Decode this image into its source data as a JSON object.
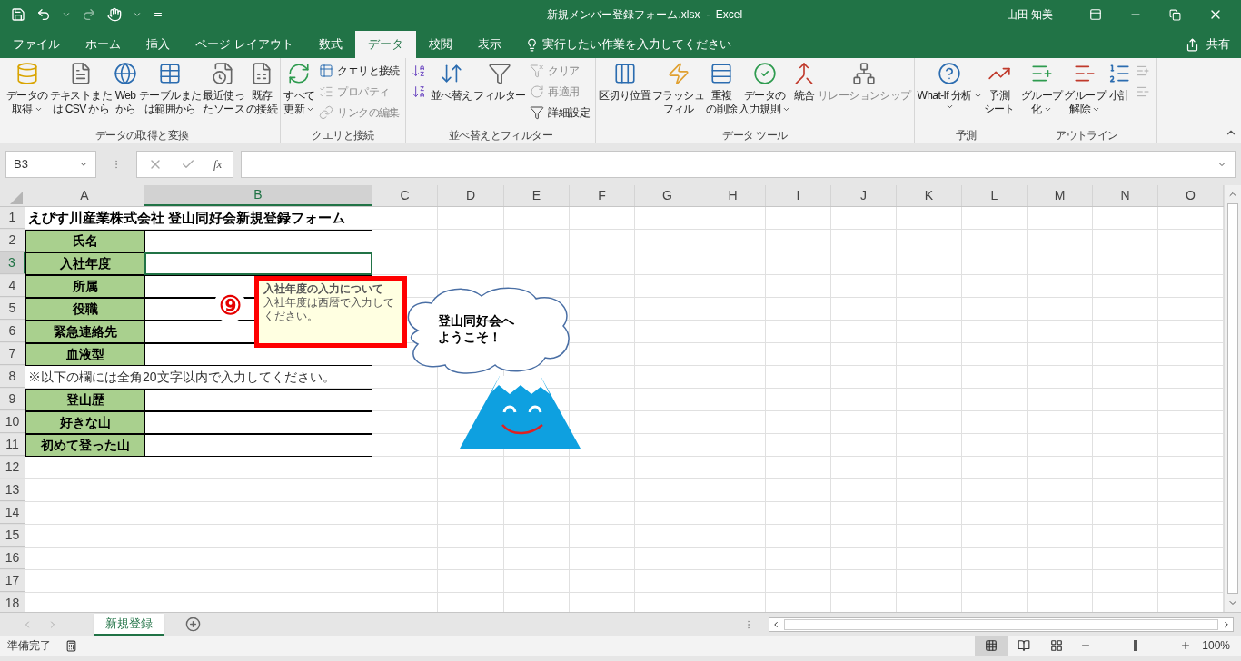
{
  "window": {
    "title": "新規メンバー登録フォーム.xlsx  -  Excel",
    "user": "山田 知美"
  },
  "tabs": [
    {
      "label": "ファイル",
      "selected": false
    },
    {
      "label": "ホーム",
      "selected": false
    },
    {
      "label": "挿入",
      "selected": false
    },
    {
      "label": "ページ レイアウト",
      "selected": false
    },
    {
      "label": "数式",
      "selected": false
    },
    {
      "label": "データ",
      "selected": true
    },
    {
      "label": "校閲",
      "selected": false
    },
    {
      "label": "表示",
      "selected": false
    }
  ],
  "tell_me": {
    "placeholder": "実行したい作業を入力してください"
  },
  "share": "共有",
  "ribbon": [
    {
      "label": "データの取得と変換",
      "items": [
        {
          "kind": "large",
          "lines": [
            "データの",
            "取得"
          ],
          "dropdown": true,
          "disabled": false
        },
        {
          "kind": "large",
          "lines": [
            "テキストまた",
            "は CSV から"
          ],
          "dropdown": false,
          "disabled": false
        },
        {
          "kind": "large",
          "lines": [
            "Web",
            "から"
          ],
          "dropdown": false,
          "disabled": false
        },
        {
          "kind": "large",
          "lines": [
            "テーブルまた",
            "は範囲から"
          ],
          "dropdown": false,
          "disabled": false
        },
        {
          "kind": "large",
          "lines": [
            "最近使っ",
            "たソース"
          ],
          "dropdown": false,
          "disabled": false
        },
        {
          "kind": "large",
          "lines": [
            "既存",
            "の接続"
          ],
          "dropdown": false,
          "disabled": false
        }
      ]
    },
    {
      "label": "クエリと接続",
      "items": [
        {
          "kind": "large",
          "lines": [
            "すべて",
            "更新"
          ],
          "dropdown": true,
          "disabled": false
        },
        {
          "kind": "stack",
          "items": [
            {
              "label": "クエリと接続",
              "disabled": false
            },
            {
              "label": "プロパティ",
              "disabled": true
            },
            {
              "label": "リンクの編集",
              "disabled": true
            }
          ]
        }
      ]
    },
    {
      "label": "並べ替えとフィルター",
      "items": [
        {
          "kind": "stack",
          "items": [
            {
              "disabled": false
            },
            {
              "disabled": false
            }
          ]
        },
        {
          "kind": "large",
          "lines": [
            "並べ替え"
          ],
          "dropdown": false,
          "disabled": false
        },
        {
          "kind": "large",
          "lines": [
            "フィルター"
          ],
          "dropdown": false,
          "disabled": false
        },
        {
          "kind": "stack",
          "items": [
            {
              "label": "クリア",
              "disabled": true
            },
            {
              "label": "再適用",
              "disabled": true
            },
            {
              "label": "詳細設定",
              "disabled": false
            }
          ]
        }
      ]
    },
    {
      "label": "データ ツール",
      "items": [
        {
          "kind": "large",
          "lines": [
            "区切り位置"
          ],
          "dropdown": false,
          "disabled": false
        },
        {
          "kind": "large",
          "lines": [
            "フラッシュ",
            "フィル"
          ],
          "dropdown": false,
          "disabled": false
        },
        {
          "kind": "large",
          "lines": [
            "重複",
            "の削除"
          ],
          "dropdown": false,
          "disabled": false
        },
        {
          "kind": "large",
          "lines": [
            "データの",
            "入力規則"
          ],
          "dropdown": true,
          "disabled": false
        },
        {
          "kind": "large",
          "lines": [
            "統合"
          ],
          "dropdown": false,
          "disabled": false
        },
        {
          "kind": "large",
          "lines": [
            "リレーションシップ"
          ],
          "dropdown": false,
          "disabled": true
        }
      ]
    },
    {
      "label": "予測",
      "items": [
        {
          "kind": "large",
          "lines": [
            "What-If 分析"
          ],
          "dropdown": true,
          "disabled": false
        },
        {
          "kind": "large",
          "lines": [
            "予測",
            "シート"
          ],
          "dropdown": false,
          "disabled": false
        }
      ]
    },
    {
      "label": "アウトライン",
      "items": [
        {
          "kind": "large",
          "lines": [
            "グループ",
            "化"
          ],
          "dropdown": true,
          "disabled": false
        },
        {
          "kind": "large",
          "lines": [
            "グループ",
            "解除"
          ],
          "dropdown": true,
          "disabled": false
        },
        {
          "kind": "large",
          "lines": [
            "小計"
          ],
          "dropdown": false,
          "disabled": false
        },
        {
          "kind": "stack",
          "items": [
            {
              "disabled": true
            },
            {
              "disabled": true
            }
          ]
        }
      ]
    }
  ],
  "name_box": "B3",
  "formula_bar": {
    "function_label": "fx"
  },
  "columns": [
    {
      "label": "A",
      "selected": false
    },
    {
      "label": "B",
      "selected": true
    },
    {
      "label": "C",
      "selected": false
    },
    {
      "label": "D",
      "selected": false
    },
    {
      "label": "E",
      "selected": false
    },
    {
      "label": "F",
      "selected": false
    },
    {
      "label": "G",
      "selected": false
    },
    {
      "label": "H",
      "selected": false
    },
    {
      "label": "I",
      "selected": false
    },
    {
      "label": "J",
      "selected": false
    },
    {
      "label": "K",
      "selected": false
    },
    {
      "label": "L",
      "selected": false
    },
    {
      "label": "M",
      "selected": false
    },
    {
      "label": "N",
      "selected": false
    },
    {
      "label": "O",
      "selected": false
    }
  ],
  "rows": [
    {
      "number": "1",
      "selected": false,
      "cells": [
        {
          "kind": "title",
          "text": "えびす川産業株式会社  登山同好会新規登録フォーム"
        }
      ]
    },
    {
      "number": "2",
      "selected": false,
      "cells": [
        {
          "kind": "label",
          "text": "氏名"
        },
        {
          "kind": "input",
          "selected": false
        }
      ]
    },
    {
      "number": "3",
      "selected": true,
      "cells": [
        {
          "kind": "label",
          "text": "入社年度"
        },
        {
          "kind": "input",
          "selected": true
        }
      ]
    },
    {
      "number": "4",
      "selected": false,
      "cells": [
        {
          "kind": "label",
          "text": "所属"
        },
        {
          "kind": "input",
          "selected": false
        }
      ]
    },
    {
      "number": "5",
      "selected": false,
      "cells": [
        {
          "kind": "label",
          "text": "役職"
        },
        {
          "kind": "input",
          "selected": false
        }
      ]
    },
    {
      "number": "6",
      "selected": false,
      "cells": [
        {
          "kind": "label",
          "text": "緊急連絡先"
        },
        {
          "kind": "input",
          "selected": false
        }
      ]
    },
    {
      "number": "7",
      "selected": false,
      "cells": [
        {
          "kind": "label",
          "text": "血液型"
        },
        {
          "kind": "input",
          "selected": false
        }
      ]
    },
    {
      "number": "8",
      "selected": false,
      "cells": [
        {
          "kind": "note",
          "text": "※以下の欄には全角20文字以内で入力してください。"
        }
      ]
    },
    {
      "number": "9",
      "selected": false,
      "cells": [
        {
          "kind": "label",
          "text": "登山歴"
        },
        {
          "kind": "input",
          "selected": false
        }
      ]
    },
    {
      "number": "10",
      "selected": false,
      "cells": [
        {
          "kind": "label",
          "text": "好きな山"
        },
        {
          "kind": "input",
          "selected": false
        }
      ]
    },
    {
      "number": "11",
      "selected": false,
      "cells": [
        {
          "kind": "label",
          "text": "初めて登った山"
        },
        {
          "kind": "input",
          "selected": false
        }
      ]
    },
    {
      "number": "12",
      "selected": false,
      "cells": []
    },
    {
      "number": "13",
      "selected": false,
      "cells": []
    },
    {
      "number": "14",
      "selected": false,
      "cells": []
    },
    {
      "number": "15",
      "selected": false,
      "cells": []
    },
    {
      "number": "16",
      "selected": false,
      "cells": []
    },
    {
      "number": "17",
      "selected": false,
      "cells": []
    },
    {
      "number": "18",
      "selected": false,
      "cells": []
    }
  ],
  "input_message": {
    "title": "入社年度の入力について",
    "body": "入社年度は西暦で入力してください。"
  },
  "step_marker": "⑨",
  "cloud": {
    "lines": [
      "登山同好会へ",
      "ようこそ！"
    ]
  },
  "sheet_tabs": [
    {
      "label": "新規登録",
      "selected": true
    }
  ],
  "status_bar": {
    "status": "準備完了",
    "views": [
      {
        "selected": true
      },
      {
        "selected": false
      },
      {
        "selected": false
      }
    ],
    "zoom": {
      "level": 0.5,
      "reading": "100%"
    }
  }
}
